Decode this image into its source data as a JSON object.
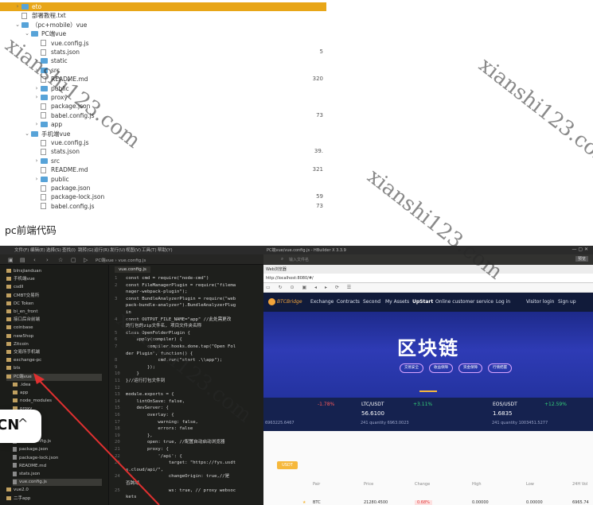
{
  "file_tree": {
    "rows": [
      {
        "name": "eto",
        "type": "folder",
        "chev": "›",
        "indent": 0,
        "selected": true,
        "size": ""
      },
      {
        "name": "部署教程.txt",
        "type": "file",
        "chev": "",
        "indent": 0,
        "selected": false,
        "size": ""
      },
      {
        "name": "（pc+mobile）vue",
        "type": "folder",
        "chev": "⌄",
        "indent": 0,
        "selected": false,
        "size": ""
      },
      {
        "name": "PC端vue",
        "type": "folder",
        "chev": "⌄",
        "indent": 1,
        "selected": false,
        "size": ""
      },
      {
        "name": "vue.config.js",
        "type": "file",
        "chev": "",
        "indent": 2,
        "selected": false,
        "size": ""
      },
      {
        "name": "stats.json",
        "type": "file",
        "chev": "",
        "indent": 2,
        "selected": false,
        "size": "5"
      },
      {
        "name": "static",
        "type": "folder",
        "chev": "›",
        "indent": 2,
        "selected": false,
        "size": ""
      },
      {
        "name": "src",
        "type": "folder",
        "chev": "›",
        "indent": 2,
        "selected": false,
        "size": ""
      },
      {
        "name": "README.md",
        "type": "file",
        "chev": "",
        "indent": 2,
        "selected": false,
        "size": "320"
      },
      {
        "name": "public",
        "type": "folder",
        "chev": "›",
        "indent": 2,
        "selected": false,
        "size": ""
      },
      {
        "name": "proxy",
        "type": "folder",
        "chev": "›",
        "indent": 2,
        "selected": false,
        "size": ""
      },
      {
        "name": "package.json",
        "type": "file",
        "chev": "",
        "indent": 2,
        "selected": false,
        "size": ""
      },
      {
        "name": "babel.config.js",
        "type": "file",
        "chev": "",
        "indent": 2,
        "selected": false,
        "size": "73"
      },
      {
        "name": "app",
        "type": "folder",
        "chev": "›",
        "indent": 2,
        "selected": false,
        "size": ""
      },
      {
        "name": "手机端vue",
        "type": "folder",
        "chev": "⌄",
        "indent": 1,
        "selected": false,
        "size": ""
      },
      {
        "name": "vue.config.js",
        "type": "file",
        "chev": "",
        "indent": 2,
        "selected": false,
        "size": ""
      },
      {
        "name": "stats.json",
        "type": "file",
        "chev": "",
        "indent": 2,
        "selected": false,
        "size": "39."
      },
      {
        "name": "src",
        "type": "folder",
        "chev": "›",
        "indent": 2,
        "selected": false,
        "size": ""
      },
      {
        "name": "README.md",
        "type": "file",
        "chev": "",
        "indent": 2,
        "selected": false,
        "size": "321"
      },
      {
        "name": "public",
        "type": "folder",
        "chev": "›",
        "indent": 2,
        "selected": false,
        "size": ""
      },
      {
        "name": "package.json",
        "type": "file",
        "chev": "",
        "indent": 2,
        "selected": false,
        "size": ""
      },
      {
        "name": "package-lock.json",
        "type": "file",
        "chev": "",
        "indent": 2,
        "selected": false,
        "size": "59"
      },
      {
        "name": "babel.config.js",
        "type": "file",
        "chev": "",
        "indent": 2,
        "selected": false,
        "size": "73"
      }
    ]
  },
  "caption": "pc前端代码",
  "ide": {
    "menu": [
      "文件(F)",
      "编辑(E)",
      "选择(S)",
      "查找(I)",
      "跳转(G)",
      "运行(R)",
      "发行(U)",
      "视图(V)",
      "工具(T)",
      "帮助(Y)"
    ],
    "breadcrumb": "PC端vue › vue.config.js",
    "sidebar": [
      {
        "name": "blnsjianduan",
        "kind": "folder",
        "hl": false
      },
      {
        "name": "手机端vue",
        "kind": "folder",
        "hl": false
      },
      {
        "name": "csdll",
        "kind": "folder",
        "hl": false
      },
      {
        "name": "CMBT交易所",
        "kind": "folder",
        "hl": false
      },
      {
        "name": "DC Token",
        "kind": "folder",
        "hl": false
      },
      {
        "name": "bi_en_front",
        "kind": "folder",
        "hl": false
      },
      {
        "name": "接口后台前端",
        "kind": "folder",
        "hl": false
      },
      {
        "name": "coinbase",
        "kind": "folder",
        "hl": false
      },
      {
        "name": "new5hop",
        "kind": "folder",
        "hl": false
      },
      {
        "name": "Zitcoin",
        "kind": "folder",
        "hl": false
      },
      {
        "name": "交易所手机端",
        "kind": "folder",
        "hl": false
      },
      {
        "name": "exchange-pc",
        "kind": "folder",
        "hl": false
      },
      {
        "name": "bts",
        "kind": "folder",
        "hl": false
      },
      {
        "name": "PC端vue",
        "kind": "folder",
        "hl": true
      },
      {
        "name": ".idea",
        "kind": "folder",
        "hl": false
      },
      {
        "name": "app",
        "kind": "folder",
        "hl": false
      },
      {
        "name": "node_modules",
        "kind": "folder",
        "hl": false
      },
      {
        "name": "proxy",
        "kind": "folder",
        "hl": false
      },
      {
        "name": "",
        "kind": "folder",
        "hl": false
      },
      {
        "name": "",
        "kind": "folder",
        "hl": false
      },
      {
        "name": "",
        "kind": "folder",
        "hl": false
      },
      {
        "name": "babel.config.js",
        "kind": "file",
        "hl": false
      },
      {
        "name": "package.json",
        "kind": "file",
        "hl": false
      },
      {
        "name": "package-lock.json",
        "kind": "file",
        "hl": false
      },
      {
        "name": "README.md",
        "kind": "file",
        "hl": false
      },
      {
        "name": "stats.json",
        "kind": "file",
        "hl": false
      },
      {
        "name": "vue.config.js",
        "kind": "file",
        "hl": true
      },
      {
        "name": "vue2.0",
        "kind": "folder",
        "hl": false
      },
      {
        "name": "二手app",
        "kind": "folder",
        "hl": false
      }
    ],
    "editor_tab": "vue.config.js",
    "code": [
      {
        "n": "1",
        "t": "const cmd = require(\"node-cmd\")"
      },
      {
        "n": "2",
        "t": "const FileManagerPlugin = require(\"filema"
      },
      {
        "n": "",
        "t": "nager-webpack-plugin\");"
      },
      {
        "n": "3",
        "t": "const BundleAnalyzerPlugin = require(\"web"
      },
      {
        "n": "",
        "t": "pack-bundle-analyzer\").BundleAnalyzerPlug"
      },
      {
        "n": "",
        "t": "in"
      },
      {
        "n": "4",
        "t": "const OUTPUT_FILE_NAME=\"app\" //此处需更改"
      },
      {
        "n": "",
        "t": "的打包的zip文件名, 项目文件夹名称"
      },
      {
        "n": "5",
        "t": "class OpenFolderPlugin {"
      },
      {
        "n": "6",
        "t": "    apply(compiler) {"
      },
      {
        "n": "7",
        "t": "        compiler.hooks.done.tap(\"Open Fol"
      },
      {
        "n": "",
        "t": "der Plugin\", function() {"
      },
      {
        "n": "8",
        "t": "            cmd.run(\"start .\\\\app\");"
      },
      {
        "n": "9",
        "t": "        });"
      },
      {
        "n": "10",
        "t": "    }"
      },
      {
        "n": "11",
        "t": "}//运行打包文件到"
      },
      {
        "n": "12",
        "t": ""
      },
      {
        "n": "13",
        "t": "module.exports = {"
      },
      {
        "n": "14",
        "t": "    lintOnSave: false,"
      },
      {
        "n": "15",
        "t": "    devServer: {"
      },
      {
        "n": "16",
        "t": "        overlay: {"
      },
      {
        "n": "17",
        "t": "            warning: false,"
      },
      {
        "n": "18",
        "t": "            errors: false"
      },
      {
        "n": "19",
        "t": "        },"
      },
      {
        "n": "20",
        "t": "        open: true, //配置自动启动浏览器"
      },
      {
        "n": "21",
        "t": "        proxy: {"
      },
      {
        "n": "22",
        "t": "            '/api': {"
      },
      {
        "n": "23",
        "t": "                target: \"https://fys.usdt"
      },
      {
        "n": "",
        "t": "s.cloud/api/\","
      },
      {
        "n": "24",
        "t": "                changeOrigin: true,//是"
      },
      {
        "n": "",
        "t": "否跨域"
      },
      {
        "n": "25",
        "t": "                ws: true, // proxy websoc"
      },
      {
        "n": "",
        "t": "kets"
      }
    ],
    "browser": {
      "title": "PC端vue/vue.config.js - HBuilder X 3.3.9",
      "search_placeholder": "输入文件名",
      "preview_label": "预览",
      "tab": "Web浏览器",
      "url": "http://localhost:8080/#/",
      "nav": [
        "Exchange",
        "Contracts",
        "Second",
        "My Assets",
        "UpStart",
        "Online customer service"
      ],
      "right_nav": [
        "Log in",
        "Visitor login",
        "Sign up"
      ],
      "logo_text": "BTCBridge",
      "banner_title": "区块链",
      "banner_pills": [
        "交易安全",
        "收益保障",
        "资金保障",
        "行情把握"
      ],
      "tickers": [
        {
          "pair": "",
          "change": "-1.78%",
          "price": "",
          "vol": "6963225.6467",
          "color": "#ff5a5a"
        },
        {
          "pair": "LTC/USDT",
          "change": "+3.11%",
          "price": "56.6100",
          "vol": "241 quantity 6963.0023",
          "color": "#34d17a"
        },
        {
          "pair": "EOS/USDT",
          "change": "+12.59%",
          "price": "1.6835",
          "vol": "241 quantity 1003451.5277",
          "color": "#34d17a"
        }
      ],
      "market_tab": "USDT",
      "market_headers": [
        "Pair",
        "Price",
        "Change",
        "High",
        "Low",
        "24H Vol"
      ],
      "market_row": {
        "pair": "BTC",
        "price": "21280.4500",
        "change": "0.68%",
        "high": "0.00000",
        "low": "0.00000",
        "vol": "6965.74"
      }
    }
  },
  "watermark_text": "xianshi123.com",
  "lang_badge": {
    "label": "CN",
    "chevron": "^"
  }
}
